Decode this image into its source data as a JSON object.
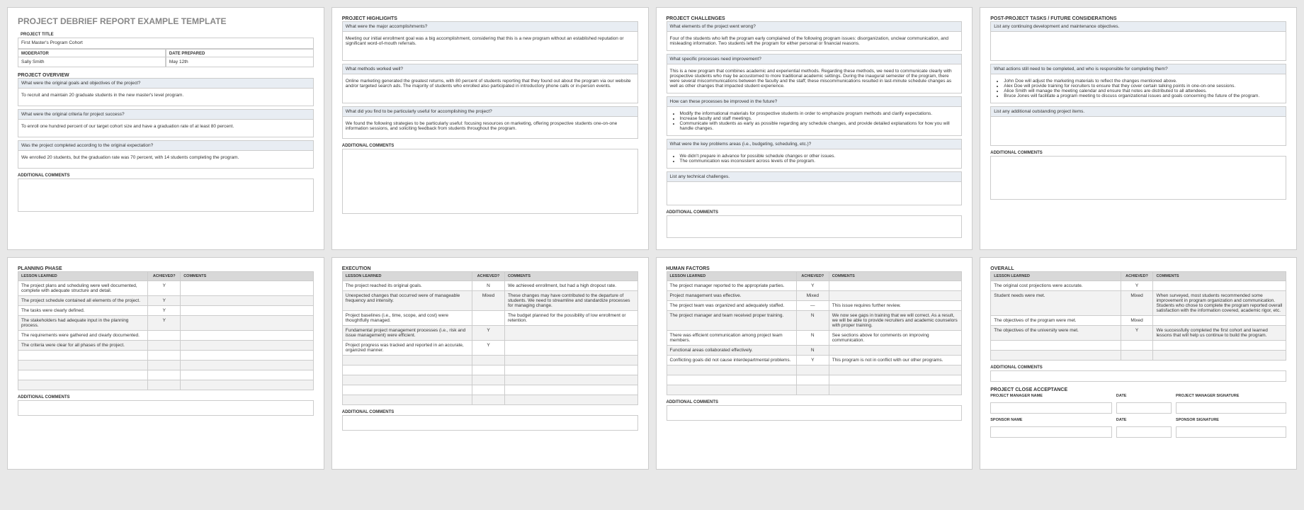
{
  "page1": {
    "title": "PROJECT DEBRIEF REPORT EXAMPLE TEMPLATE",
    "labels": {
      "projectTitle": "PROJECT TITLE",
      "moderator": "MODERATOR",
      "datePrepared": "DATE PREPARED"
    },
    "projectTitle": "First Master's Program Cohort",
    "moderator": "Sally Smith",
    "datePrepared": "May 12th",
    "overview": {
      "heading": "PROJECT OVERVIEW",
      "q1": "What were the original goals and objectives of the project?",
      "a1": "To recruit and maintain 20 graduate students in the new master's level program.",
      "q2": "What were the original criteria for project success?",
      "a2": "To enroll one hundred percent of our target cohort size and have a graduation rate of at least 80 percent.",
      "q3": "Was the project completed according to the original expectation?",
      "a3": "We enrolled 20 students, but the graduation rate was 70 percent, with 14 students completing the program.",
      "additional": "Additional Comments"
    }
  },
  "page2": {
    "heading": "PROJECT HIGHLIGHTS",
    "q1": "What were the major accomplishments?",
    "a1": "Meeting our initial enrollment goal was a big accomplishment, considering that this is a new program without an established reputation or significant word-of-mouth referrals.",
    "q2": "What methods worked well?",
    "a2": "Online marketing generated the greatest returns, with 80 percent of students reporting that they found out about the program via our website and/or targeted search ads. The majority of students who enrolled also participated in introductory phone calls or in-person events.",
    "q3": "What did you find to be particularly useful for accomplishing the project?",
    "a3": "We found the following strategies to be particularly useful: focusing resources on marketing, offering prospective students one-on-one information sessions, and soliciting feedback from students throughout the program.",
    "additional": "Additional Comments"
  },
  "page3": {
    "heading": "PROJECT CHALLENGES",
    "q1": "What elements of the project went wrong?",
    "a1": "Four of the students who left the program early complained of the following program issues: disorganization, unclear communication, and misleading information. Two students left the program for either personal or financial reasons.",
    "q2": "What specific processes need improvement?",
    "a2": "This is a new program that combines academic and experiential methods. Regarding these methods, we need to communicate clearly with prospective students who may be accustomed to more traditional academic settings. During the inaugural semester of the program, there were several miscommunications between the faculty and the staff; these miscommunications resulted in last-minute schedule changes as well as other changes that impacted student experience.",
    "q3": "How can these processes be improved in the future?",
    "a3": [
      "Modify the informational materials for prospective students in order to emphasize program methods and clarify expectations.",
      "Increase faculty and staff meetings.",
      "Communicate with students as early as possible regarding any schedule changes, and provide detailed explanations for how you will handle changes."
    ],
    "q4": "What were the key problems areas (i.e., budgeting, scheduling, etc.)?",
    "a4": [
      "We didn't prepare in advance for possible schedule changes or other issues.",
      "The communication was inconsistent across levels of the program."
    ],
    "q5": "List any technical challenges.",
    "additional": "Additional Comments"
  },
  "page4": {
    "heading": "POST-PROJECT TASKS / FUTURE CONSIDERATIONS",
    "q1": "List any continuing development and maintenance objectives.",
    "q2": "What actions still need to be completed, and who is responsible for completing them?",
    "a2": [
      "John Doe will adjust the marketing materials to reflect the changes mentioned above.",
      "Alex Doe will provide training for recruiters to ensure that they cover certain talking points in one-on-one sessions.",
      "Alice Smith will manage the meeting calendar and ensure that notes are distributed to all attendees.",
      "Bruce Jones will facilitate a program meeting to discuss organizational issues and goals concerning the future of the program."
    ],
    "q3": "List any additional outstanding project items.",
    "additional": "Additional Comments"
  },
  "page5": {
    "heading": "PLANNING PHASE",
    "cols": {
      "c1": "LESSON LEARNED",
      "c2": "ACHIEVED?",
      "c3": "COMMENTS"
    },
    "rows": [
      {
        "lesson": "The project plans and scheduling were well documented, complete with adequate structure and detail.",
        "achieved": "Y",
        "comment": ""
      },
      {
        "lesson": "The project schedule contained all elements of the project.",
        "achieved": "Y",
        "comment": ""
      },
      {
        "lesson": "The tasks were clearly defined.",
        "achieved": "Y",
        "comment": ""
      },
      {
        "lesson": "The stakeholders had adequate input in the planning process.",
        "achieved": "Y",
        "comment": ""
      },
      {
        "lesson": "The requirements were gathered and clearly documented.",
        "achieved": "",
        "comment": ""
      },
      {
        "lesson": "The criteria were clear for all phases of the project.",
        "achieved": "",
        "comment": ""
      },
      {
        "lesson": "",
        "achieved": "",
        "comment": ""
      },
      {
        "lesson": "",
        "achieved": "",
        "comment": ""
      },
      {
        "lesson": "",
        "achieved": "",
        "comment": ""
      },
      {
        "lesson": "",
        "achieved": "",
        "comment": ""
      }
    ],
    "additional": "Additional Comments"
  },
  "page6": {
    "heading": "EXECUTION",
    "cols": {
      "c1": "LESSON LEARNED",
      "c2": "ACHIEVED?",
      "c3": "COMMENTS"
    },
    "rows": [
      {
        "lesson": "The project reached its original goals.",
        "achieved": "N",
        "comment": "We achieved enrollment, but had a high dropout rate."
      },
      {
        "lesson": "Unexpected changes that occurred were of manageable frequency and intensity.",
        "achieved": "Mixed",
        "comment": "These changes may have contributed to the departure of students. We need to streamline and standardize processes for managing change."
      },
      {
        "lesson": "Project baselines (i.e., time, scope, and cost) were thoughtfully managed.",
        "achieved": "",
        "comment": "The budget planned for the possibility of low enrollment or retention."
      },
      {
        "lesson": "Fundamental project management processes (i.e., risk and issue management) were efficient.",
        "achieved": "Y",
        "comment": ""
      },
      {
        "lesson": "Project progress was tracked and reported in an accurate, organized manner.",
        "achieved": "Y",
        "comment": ""
      },
      {
        "lesson": "",
        "achieved": "",
        "comment": ""
      },
      {
        "lesson": "",
        "achieved": "",
        "comment": ""
      },
      {
        "lesson": "",
        "achieved": "",
        "comment": ""
      },
      {
        "lesson": "",
        "achieved": "",
        "comment": ""
      },
      {
        "lesson": "",
        "achieved": "",
        "comment": ""
      }
    ],
    "additional": "Additional Comments"
  },
  "page7": {
    "heading": "HUMAN FACTORS",
    "cols": {
      "c1": "LESSON LEARNED",
      "c2": "ACHIEVED?",
      "c3": "COMMENTS"
    },
    "rows": [
      {
        "lesson": "The project manager reported to the appropriate parties.",
        "achieved": "Y",
        "comment": ""
      },
      {
        "lesson": "Project management was effective.",
        "achieved": "Mixed",
        "comment": ""
      },
      {
        "lesson": "The project team was organized and adequately staffed.",
        "achieved": "—",
        "comment": "This issue requires further review."
      },
      {
        "lesson": "The project manager and team received proper training.",
        "achieved": "N",
        "comment": "We now see gaps in training that we will correct. As a result, we will be able to provide recruiters and academic counselors with proper training."
      },
      {
        "lesson": "There was efficient communication among project team members.",
        "achieved": "N",
        "comment": "See sections above for comments on improving communication."
      },
      {
        "lesson": "Functional areas collaborated effectively.",
        "achieved": "N",
        "comment": ""
      },
      {
        "lesson": "Conflicting goals did not cause interdepartmental problems.",
        "achieved": "Y",
        "comment": "This program is not in conflict with our other programs."
      },
      {
        "lesson": "",
        "achieved": "",
        "comment": ""
      },
      {
        "lesson": "",
        "achieved": "",
        "comment": ""
      },
      {
        "lesson": "",
        "achieved": "",
        "comment": ""
      }
    ],
    "additional": "Additional Comments"
  },
  "page8": {
    "heading": "OVERALL",
    "cols": {
      "c1": "LESSON LEARNED",
      "c2": "ACHIEVED?",
      "c3": "COMMENTS"
    },
    "rows": [
      {
        "lesson": "The original cost projections were accurate.",
        "achieved": "Y",
        "comment": ""
      },
      {
        "lesson": "Student needs were met.",
        "achieved": "Mixed",
        "comment": "When surveyed, most students recommended some improvement in program organization and communication. Students who chose to complete the program reported overall satisfaction with the information covered, academic rigor, etc."
      },
      {
        "lesson": "The objectives of the program were met.",
        "achieved": "Mixed",
        "comment": ""
      },
      {
        "lesson": "The objectives of the university were met.",
        "achieved": "Y",
        "comment": "We successfully completed the first cohort and learned lessons that will help us continue to build the program."
      },
      {
        "lesson": "",
        "achieved": "",
        "comment": ""
      },
      {
        "lesson": "",
        "achieved": "",
        "comment": ""
      }
    ],
    "additional": "Additional Comments",
    "closeHeading": "PROJECT CLOSE ACCEPTANCE",
    "sig": {
      "pmName": "PROJECT MANAGER NAME",
      "date": "DATE",
      "pmSig": "PROJECT MANAGER SIGNATURE",
      "sponsorName": "SPONSOR NAME",
      "sponsorSig": "SPONSOR SIGNATURE"
    }
  }
}
